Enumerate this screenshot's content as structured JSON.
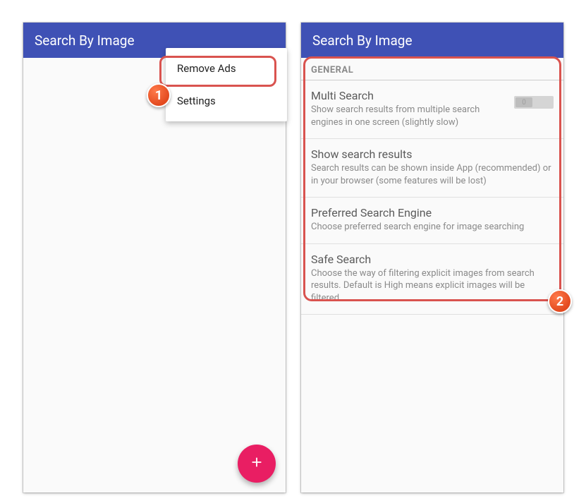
{
  "left": {
    "appTitle": "Search By Image",
    "menu": {
      "removeAds": "Remove Ads",
      "settings": "Settings"
    }
  },
  "right": {
    "appTitle": "Search By Image",
    "sectionHeader": "GENERAL",
    "settings": [
      {
        "title": "Multi Search",
        "desc": "Show search results from multiple search engines in one screen (slightly slow)",
        "switchLabel": "0"
      },
      {
        "title": "Show search results",
        "desc": "Search results can be shown inside App (recommended) or in your browser (some features will be lost)"
      },
      {
        "title": "Preferred Search Engine",
        "desc": "Choose preferred search engine for image searching"
      },
      {
        "title": "Safe Search",
        "desc": "Choose the way of filtering explicit images from search results. Default is High means explicit images will be filtered."
      }
    ]
  },
  "badges": {
    "one": "1",
    "two": "2"
  }
}
